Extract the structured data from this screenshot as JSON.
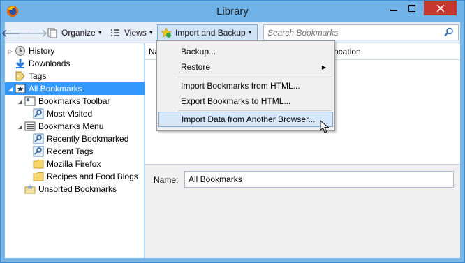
{
  "window": {
    "title": "Library"
  },
  "toolbar": {
    "organize_label": "Organize",
    "views_label": "Views",
    "import_backup_label": "Import and Backup",
    "search_placeholder": "Search Bookmarks"
  },
  "tree": {
    "items": [
      {
        "label": "History",
        "icon": "history-icon"
      },
      {
        "label": "Downloads",
        "icon": "download-arrow-icon"
      },
      {
        "label": "Tags",
        "icon": "tag-icon"
      },
      {
        "label": "All Bookmarks",
        "icon": "star-folder-icon"
      },
      {
        "label": "Bookmarks Toolbar",
        "icon": "toolbar-folder-icon"
      },
      {
        "label": "Most Visited",
        "icon": "smart-query-icon"
      },
      {
        "label": "Bookmarks Menu",
        "icon": "menu-folder-icon"
      },
      {
        "label": "Recently Bookmarked",
        "icon": "smart-query-icon"
      },
      {
        "label": "Recent Tags",
        "icon": "smart-query-icon"
      },
      {
        "label": "Mozilla Firefox",
        "icon": "folder-icon"
      },
      {
        "label": "Recipes and Food Blogs",
        "icon": "folder-icon"
      },
      {
        "label": "Unsorted Bookmarks",
        "icon": "unsorted-folder-icon"
      }
    ]
  },
  "columns": {
    "name": "Na",
    "location": "ocation"
  },
  "details": {
    "name_label": "Name:",
    "name_value": "All Bookmarks"
  },
  "menu": {
    "items": [
      {
        "label": "Backup..."
      },
      {
        "label": "Restore"
      },
      {
        "label": "Import Bookmarks from HTML..."
      },
      {
        "label": "Export Bookmarks to HTML..."
      },
      {
        "label": "Import Data from Another Browser..."
      }
    ]
  },
  "colors": {
    "titlebar": "#6fb3e8",
    "selection": "#3399ff",
    "close_button": "#c7362f",
    "menu_hover": "#d5e7f8"
  }
}
